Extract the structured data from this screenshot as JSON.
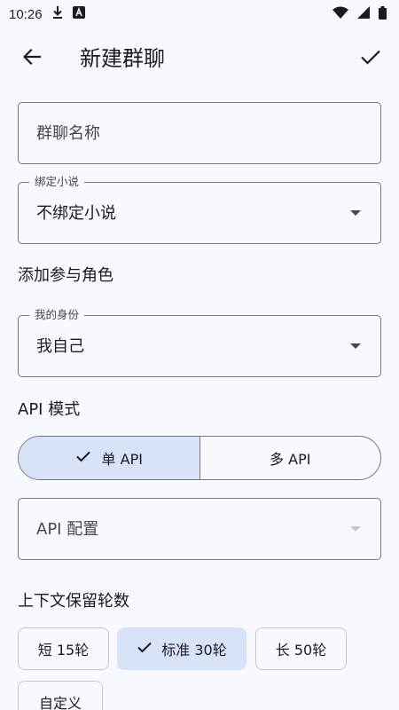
{
  "status_bar": {
    "time": "10:26"
  },
  "app_bar": {
    "title": "新建群聊"
  },
  "group_name": {
    "placeholder": "群聊名称"
  },
  "bind_novel": {
    "label": "绑定小说",
    "value": "不绑定小说"
  },
  "add_roles": {
    "title": "添加参与角色"
  },
  "my_identity": {
    "label": "我的身份",
    "value": "我自己"
  },
  "api_mode": {
    "title": "API 模式",
    "options": [
      "单 API",
      "多 API"
    ],
    "selected": "单 API"
  },
  "api_config": {
    "placeholder": "API 配置"
  },
  "context_rounds": {
    "title": "上下文保留轮数",
    "options": [
      "短 15轮",
      "标准 30轮",
      "长 50轮",
      "自定义"
    ],
    "selected": "标准 30轮"
  },
  "colors": {
    "background": "#F8F9FE",
    "selected_fill": "#D8E2F9",
    "outline": "#74777F",
    "text": "#1B1B1F"
  }
}
